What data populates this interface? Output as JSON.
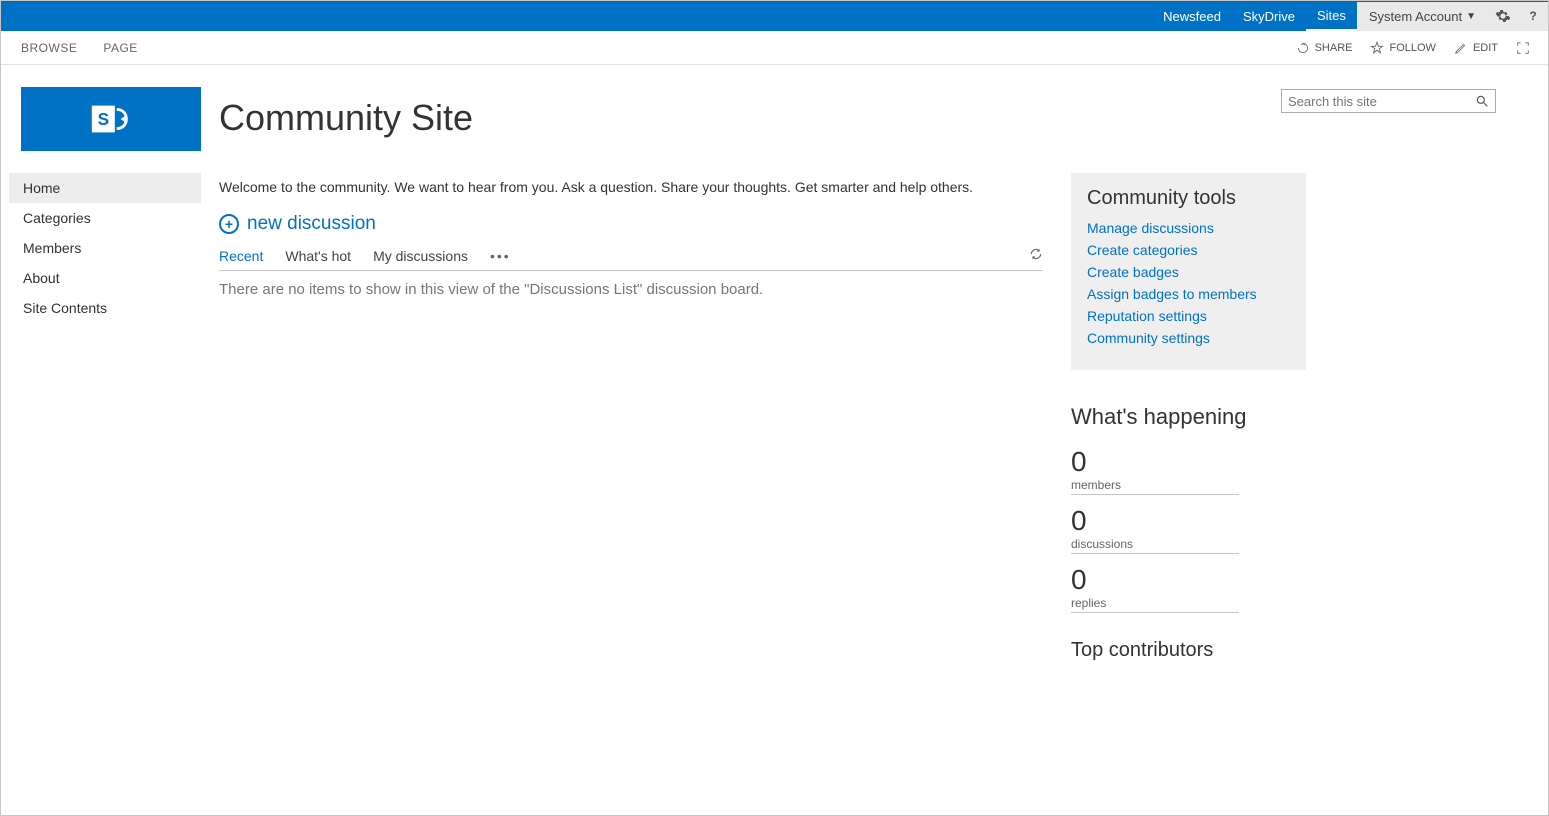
{
  "suitebar": {
    "links": [
      "Newsfeed",
      "SkyDrive",
      "Sites"
    ],
    "active_index": 2,
    "user": "System Account"
  },
  "ribbon": {
    "tabs": [
      "BROWSE",
      "PAGE"
    ],
    "actions": {
      "share": "SHARE",
      "follow": "FOLLOW",
      "edit": "EDIT"
    }
  },
  "header": {
    "title": "Community Site",
    "search_placeholder": "Search this site"
  },
  "leftnav": {
    "items": [
      "Home",
      "Categories",
      "Members",
      "About",
      "Site Contents"
    ],
    "selected_index": 0
  },
  "main": {
    "welcome": "Welcome to the community. We want to hear from you. Ask a question. Share your thoughts. Get smarter and help others.",
    "new_discussion_label": "new discussion",
    "tabs": [
      "Recent",
      "What's hot",
      "My discussions"
    ],
    "active_tab_index": 0,
    "empty_message": "There are no items to show in this view of the \"Discussions List\" discussion board."
  },
  "tools": {
    "title": "Community tools",
    "links": [
      "Manage discussions",
      "Create categories",
      "Create badges",
      "Assign badges to members",
      "Reputation settings",
      "Community settings"
    ]
  },
  "whats_happening": {
    "title": "What's happening",
    "stats": [
      {
        "value": "0",
        "label": "members"
      },
      {
        "value": "0",
        "label": "discussions"
      },
      {
        "value": "0",
        "label": "replies"
      }
    ]
  },
  "top_contributors": {
    "title": "Top contributors"
  }
}
